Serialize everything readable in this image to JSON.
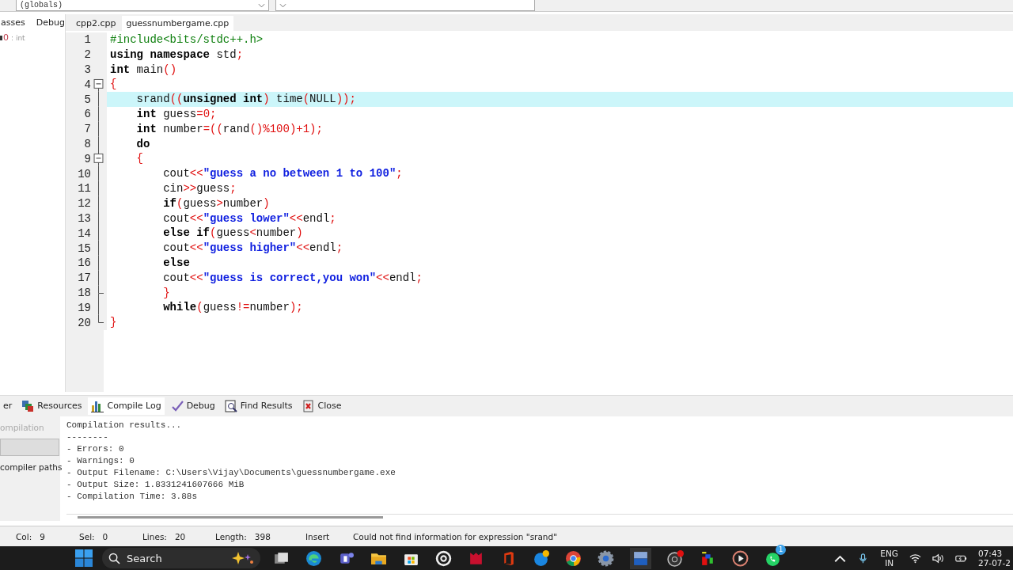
{
  "toolbar": {
    "scope_dropdown": "(globals)"
  },
  "left_panel": {
    "tabs": [
      {
        "label": "asses",
        "selected": false
      },
      {
        "label": "Debug",
        "selected": false
      }
    ],
    "item": {
      "value": "0",
      "type": ": int"
    }
  },
  "editor_tabs": [
    {
      "label": "cpp2.cpp",
      "selected": false
    },
    {
      "label": "guessnumbergame.cpp",
      "selected": true
    }
  ],
  "code_lines": [
    {
      "number": "1",
      "current": false,
      "tokens": [
        {
          "kind": "pp",
          "text": "#include<bits/stdc++.h>"
        }
      ]
    },
    {
      "number": "2",
      "current": false,
      "tokens": [
        {
          "kind": "kw",
          "text": "using namespace"
        },
        {
          "kind": "plain",
          "text": " std"
        },
        {
          "kind": "sym",
          "text": ";"
        }
      ]
    },
    {
      "number": "3",
      "current": false,
      "tokens": [
        {
          "kind": "kw",
          "text": "int"
        },
        {
          "kind": "plain",
          "text": " main"
        },
        {
          "kind": "sym",
          "text": "()"
        }
      ]
    },
    {
      "number": "4",
      "current": false,
      "kind": "fold_start",
      "tokens": [
        {
          "kind": "sym",
          "text": "{"
        }
      ]
    },
    {
      "number": "5",
      "current": true,
      "tokens": [
        {
          "kind": "plain",
          "text": "    srand"
        },
        {
          "kind": "sym",
          "text": "(("
        },
        {
          "kind": "kw",
          "text": "unsigned int"
        },
        {
          "kind": "sym",
          "text": ")"
        },
        {
          "kind": "plain",
          "text": " time"
        },
        {
          "kind": "sym",
          "text": "("
        },
        {
          "kind": "plain",
          "text": "NULL"
        },
        {
          "kind": "sym",
          "text": "));"
        }
      ]
    },
    {
      "number": "6",
      "current": false,
      "tokens": [
        {
          "kind": "kw",
          "text": "    int"
        },
        {
          "kind": "plain",
          "text": " guess"
        },
        {
          "kind": "sym",
          "text": "="
        },
        {
          "kind": "num",
          "text": "0"
        },
        {
          "kind": "sym",
          "text": ";"
        }
      ]
    },
    {
      "number": "7",
      "current": false,
      "tokens": [
        {
          "kind": "kw",
          "text": "    int"
        },
        {
          "kind": "plain",
          "text": " number"
        },
        {
          "kind": "sym",
          "text": "=(("
        },
        {
          "kind": "plain",
          "text": "rand"
        },
        {
          "kind": "sym",
          "text": "()%"
        },
        {
          "kind": "num",
          "text": "100"
        },
        {
          "kind": "sym",
          "text": ")+"
        },
        {
          "kind": "num",
          "text": "1"
        },
        {
          "kind": "sym",
          "text": ");"
        }
      ]
    },
    {
      "number": "8",
      "current": false,
      "tokens": [
        {
          "kind": "kw",
          "text": "    do"
        }
      ]
    },
    {
      "number": "9",
      "current": false,
      "kind": "fold_start",
      "tokens": [
        {
          "kind": "sym",
          "text": "    {"
        }
      ]
    },
    {
      "number": "10",
      "current": false,
      "tokens": [
        {
          "kind": "plain",
          "text": "        cout"
        },
        {
          "kind": "sym",
          "text": "<<"
        },
        {
          "kind": "str",
          "text": "\"guess a no between 1 to 100\""
        },
        {
          "kind": "sym",
          "text": ";"
        }
      ]
    },
    {
      "number": "11",
      "current": false,
      "tokens": [
        {
          "kind": "plain",
          "text": "        cin"
        },
        {
          "kind": "sym",
          "text": ">>"
        },
        {
          "kind": "plain",
          "text": "guess"
        },
        {
          "kind": "sym",
          "text": ";"
        }
      ]
    },
    {
      "number": "12",
      "current": false,
      "tokens": [
        {
          "kind": "kw",
          "text": "        if"
        },
        {
          "kind": "sym",
          "text": "("
        },
        {
          "kind": "plain",
          "text": "guess"
        },
        {
          "kind": "sym",
          "text": ">"
        },
        {
          "kind": "plain",
          "text": "number"
        },
        {
          "kind": "sym",
          "text": ")"
        }
      ]
    },
    {
      "number": "13",
      "current": false,
      "tokens": [
        {
          "kind": "plain",
          "text": "        cout"
        },
        {
          "kind": "sym",
          "text": "<<"
        },
        {
          "kind": "str",
          "text": "\"guess lower\""
        },
        {
          "kind": "sym",
          "text": "<<"
        },
        {
          "kind": "plain",
          "text": "endl"
        },
        {
          "kind": "sym",
          "text": ";"
        }
      ]
    },
    {
      "number": "14",
      "current": false,
      "tokens": [
        {
          "kind": "kw",
          "text": "        else if"
        },
        {
          "kind": "sym",
          "text": "("
        },
        {
          "kind": "plain",
          "text": "guess"
        },
        {
          "kind": "sym",
          "text": "<"
        },
        {
          "kind": "plain",
          "text": "number"
        },
        {
          "kind": "sym",
          "text": ")"
        }
      ]
    },
    {
      "number": "15",
      "current": false,
      "tokens": [
        {
          "kind": "plain",
          "text": "        cout"
        },
        {
          "kind": "sym",
          "text": "<<"
        },
        {
          "kind": "str",
          "text": "\"guess higher\""
        },
        {
          "kind": "sym",
          "text": "<<"
        },
        {
          "kind": "plain",
          "text": "endl"
        },
        {
          "kind": "sym",
          "text": ";"
        }
      ]
    },
    {
      "number": "16",
      "current": false,
      "tokens": [
        {
          "kind": "kw",
          "text": "        else"
        }
      ]
    },
    {
      "number": "17",
      "current": false,
      "tokens": [
        {
          "kind": "plain",
          "text": "        cout"
        },
        {
          "kind": "sym",
          "text": "<<"
        },
        {
          "kind": "str",
          "text": "\"guess is correct,you won\""
        },
        {
          "kind": "sym",
          "text": "<<"
        },
        {
          "kind": "plain",
          "text": "endl"
        },
        {
          "kind": "sym",
          "text": ";"
        }
      ]
    },
    {
      "number": "18",
      "current": false,
      "kind": "fold_end",
      "tokens": [
        {
          "kind": "sym",
          "text": "        }"
        }
      ]
    },
    {
      "number": "19",
      "current": false,
      "tokens": [
        {
          "kind": "kw",
          "text": "        while"
        },
        {
          "kind": "sym",
          "text": "("
        },
        {
          "kind": "plain",
          "text": "guess"
        },
        {
          "kind": "sym",
          "text": "!="
        },
        {
          "kind": "plain",
          "text": "number"
        },
        {
          "kind": "sym",
          "text": ");"
        }
      ]
    },
    {
      "number": "20",
      "current": false,
      "kind": "fold_end",
      "tokens": [
        {
          "kind": "sym",
          "text": "}"
        }
      ]
    }
  ],
  "bottom_tabs": [
    {
      "label": "er",
      "kind": "plain",
      "selected": false
    },
    {
      "label": "Resources",
      "kind": "resources",
      "selected": false
    },
    {
      "label": "Compile Log",
      "kind": "chart",
      "selected": true
    },
    {
      "label": "Debug",
      "kind": "check",
      "selected": false
    },
    {
      "label": "Find Results",
      "kind": "find",
      "selected": false
    },
    {
      "label": "Close",
      "kind": "close",
      "selected": false
    }
  ],
  "compile_side": {
    "items": [
      {
        "label": "ompilation",
        "kind": "text",
        "disabled": true
      },
      {
        "kind": "button",
        "disabled": true
      },
      {
        "label": "compiler paths",
        "kind": "text",
        "disabled": false
      }
    ]
  },
  "compile_log": [
    "Compilation results...",
    "--------",
    "- Errors: 0",
    "- Warnings: 0",
    "- Output Filename: C:\\Users\\Vijay\\Documents\\guessnumbergame.exe",
    "- Output Size: 1.8331241607666 MiB",
    "- Compilation Time: 3.88s"
  ],
  "status_bar": [
    {
      "label": "Col:",
      "value": "9"
    },
    {
      "label": "Sel:",
      "value": "0"
    },
    {
      "label": "Lines:",
      "value": "20"
    },
    {
      "label": "Length:",
      "value": "398"
    },
    {
      "value": "Insert"
    },
    {
      "value": "Could not find information for expression \"srand\""
    }
  ],
  "taskbar": {
    "search_placeholder": "Search",
    "whatsapp_badge": "1",
    "language": "ENG",
    "region": "IN",
    "time": "07:43",
    "date": "27-07-2"
  }
}
